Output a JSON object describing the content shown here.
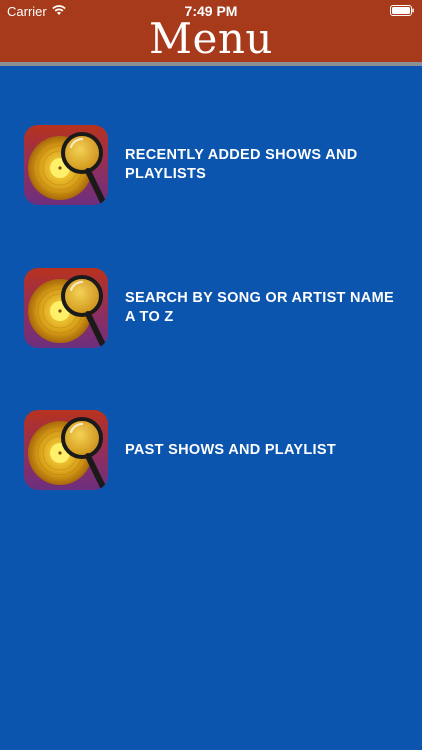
{
  "status_bar": {
    "carrier": "Carrier",
    "time": "7:49 PM",
    "wifi_icon": "wifi-icon",
    "battery_icon": "battery-icon"
  },
  "header": {
    "title": "Menu",
    "bar_color": "#a63a1a"
  },
  "background_color": "#0b55af",
  "menu": {
    "items": [
      {
        "label": "RECENTLY ADDED SHOWS AND PLAYLISTS",
        "icon": "record-magnifier-icon"
      },
      {
        "label": "SEARCH BY SONG OR ARTIST NAME A TO Z",
        "icon": "record-magnifier-icon"
      },
      {
        "label": "PAST SHOWS AND PLAYLIST",
        "icon": "record-magnifier-icon"
      }
    ]
  }
}
